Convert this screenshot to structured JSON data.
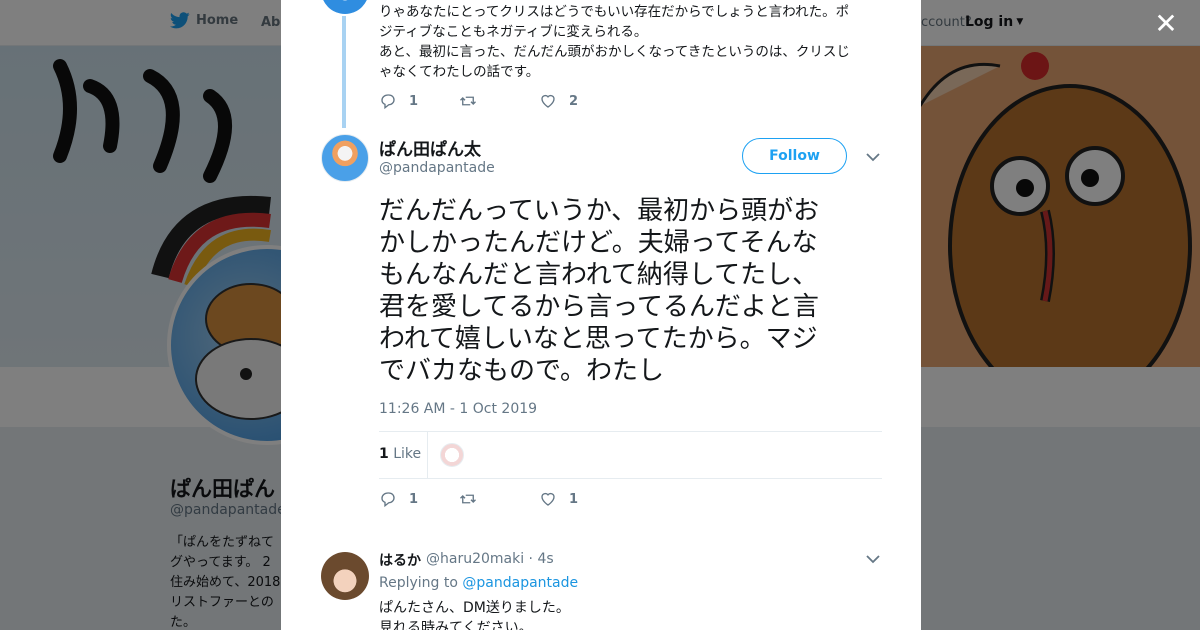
{
  "nav": {
    "home_label": "Home",
    "about_label": "Abo",
    "account_prompt": "ccount?",
    "login_label": "Log in"
  },
  "profile": {
    "name": "ぱん田ぱん",
    "handle": "@pandapantade",
    "bio_lines": [
      "「ぱんをたずねて",
      "グやってます。 2",
      "住み始めて、2018",
      "リストファーとの",
      "た。"
    ]
  },
  "close_label": "✕",
  "prev_tweet": {
    "text_lines": [
      "りゃあなたにとってクリスはどうでもいい存在だからでしょうと言われた。ポ",
      "ジティブなこともネガティブに変えられる。",
      "あと、最初に言った、だんだん頭がおかしくなってきたというのは、クリスじ",
      "ゃなくてわたしの話です。"
    ],
    "replies": "1",
    "retweets": "",
    "likes": "2"
  },
  "main_tweet": {
    "name": "ぱん田ぱん太",
    "handle": "@pandapantade",
    "follow_label": "Follow",
    "text_lines": [
      "だんだんっていうか、最初から頭がお",
      "かしかったんだけど。夫婦ってそんな",
      "もんなんだと言われて納得してたし、",
      "君を愛してるから言ってるんだよと言",
      "われて嬉しいなと思ってたから。マジ",
      "でバカなもので。わたし"
    ],
    "timestamp": "11:26 AM - 1 Oct 2019",
    "like_count": "1",
    "like_word": "Like",
    "replies": "1",
    "retweets": "",
    "likes": "1"
  },
  "reply": {
    "name": "はるか",
    "meta": "@haru20maki · 4s",
    "replying_prefix": "Replying to",
    "replying_to": "@pandapantade",
    "text_lines": [
      "ぱんたさん、DM送りました。",
      "見れる時みてください。"
    ]
  },
  "colors": {
    "accent": "#1da1f2",
    "thread_line": "#a8d2f2",
    "muted_text": "#657786"
  }
}
